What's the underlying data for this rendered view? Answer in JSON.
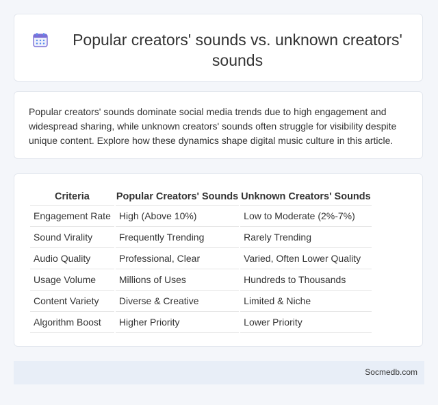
{
  "header": {
    "icon": "calendar-icon",
    "title": "Popular creators' sounds vs. unknown creators' sounds"
  },
  "intro": {
    "text": "Popular creators' sounds dominate social media trends due to high engagement and widespread sharing, while unknown creators' sounds often struggle for visibility despite unique content. Explore how these dynamics shape digital music culture in this article."
  },
  "table": {
    "headers": [
      "Criteria",
      "Popular Creators' Sounds",
      "Unknown Creators' Sounds"
    ],
    "rows": [
      [
        "Engagement Rate",
        "High (Above 10%)",
        "Low to Moderate (2%-7%)"
      ],
      [
        "Sound Virality",
        "Frequently Trending",
        "Rarely Trending"
      ],
      [
        "Audio Quality",
        "Professional, Clear",
        "Varied, Often Lower Quality"
      ],
      [
        "Usage Volume",
        "Millions of Uses",
        "Hundreds to Thousands"
      ],
      [
        "Content Variety",
        "Diverse & Creative",
        "Limited & Niche"
      ],
      [
        "Algorithm Boost",
        "Higher Priority",
        "Lower Priority"
      ]
    ]
  },
  "footer": {
    "site": "Socmedb.com"
  },
  "colors": {
    "page_background": "#f4f6fa",
    "card_background": "#ffffff",
    "footer_background": "#e8eef7",
    "icon_purple": "#7b6fd6",
    "icon_blue": "#5b8def"
  }
}
